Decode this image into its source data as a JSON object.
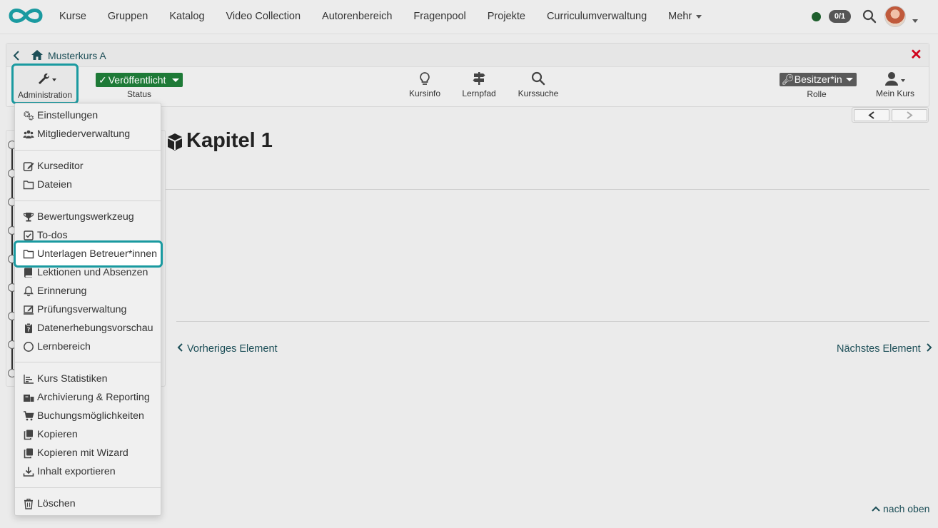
{
  "topnav": {
    "items": [
      "Kurse",
      "Gruppen",
      "Katalog",
      "Video Collection",
      "Autorenbereich",
      "Fragenpool",
      "Projekte",
      "Curriculumverwaltung",
      "Mehr"
    ],
    "online_count": "0/1",
    "brand_color": "#1a9aa0"
  },
  "breadcrumb": {
    "title": "Musterkurs A"
  },
  "toolbar": {
    "administration": "Administration",
    "status_value": "Veröffentlicht",
    "status_label": "Status",
    "kursinfo": "Kursinfo",
    "lernpfad": "Lernpfad",
    "kurssuche": "Kurssuche",
    "role_value": "Besitzer*in",
    "role_label": "Rolle",
    "mein_kurs": "Mein Kurs"
  },
  "admin_menu": {
    "items": [
      {
        "label": "Einstellungen",
        "icon": "gears-icon"
      },
      {
        "label": "Mitgliederverwaltung",
        "icon": "users-icon"
      },
      {
        "label": "Kurseditor",
        "icon": "edit-icon"
      },
      {
        "label": "Dateien",
        "icon": "folder-icon"
      },
      {
        "label": "Bewertungswerkzeug",
        "icon": "trophy-icon"
      },
      {
        "label": "To-dos",
        "icon": "checkbox-icon"
      },
      {
        "label": "Unterlagen Betreuer*innen",
        "icon": "folder-icon"
      },
      {
        "label": "Lektionen und Absenzen",
        "icon": "book-icon"
      },
      {
        "label": "Erinnerung",
        "icon": "bell-icon"
      },
      {
        "label": "Prüfungsverwaltung",
        "icon": "exam-icon"
      },
      {
        "label": "Datenerhebungsvorschau",
        "icon": "clipboard-icon"
      },
      {
        "label": "Lernbereich",
        "icon": "circle-icon"
      },
      {
        "label": "Kurs Statistiken",
        "icon": "chart-icon"
      },
      {
        "label": "Archivierung & Reporting",
        "icon": "archive-icon"
      },
      {
        "label": "Buchungsmöglichkeiten",
        "icon": "cart-icon"
      },
      {
        "label": "Kopieren",
        "icon": "copy-icon"
      },
      {
        "label": "Kopieren mit Wizard",
        "icon": "copy-icon"
      },
      {
        "label": "Inhalt exportieren",
        "icon": "download-icon"
      },
      {
        "label": "Löschen",
        "icon": "trash-icon"
      }
    ]
  },
  "content": {
    "chapter_title": "Kapitel 1",
    "prev_label": "Vorheriges Element",
    "next_label": "Nächstes Element",
    "to_top_label": "nach oben"
  }
}
